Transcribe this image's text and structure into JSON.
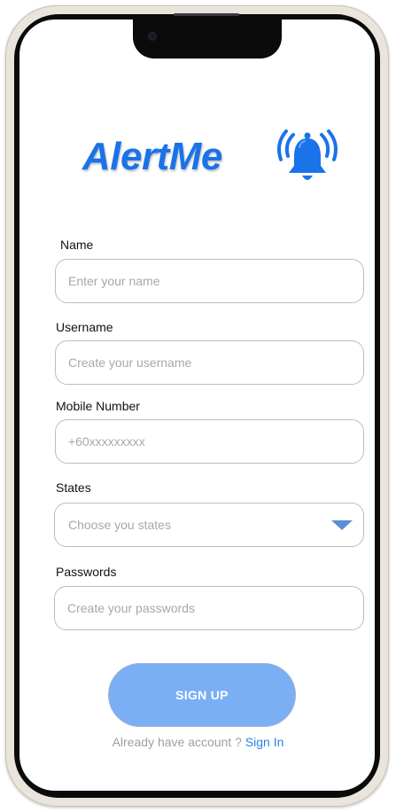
{
  "app": {
    "logo_text": "AlertMe",
    "brand_color": "#1a73e8",
    "logo_icon": "bell-icon"
  },
  "form": {
    "name": {
      "label": "Name",
      "placeholder": "Enter your name",
      "value": ""
    },
    "username": {
      "label": "Username",
      "placeholder": "Create your username",
      "value": ""
    },
    "mobile": {
      "label": "Mobile Number",
      "placeholder": "+60xxxxxxxxx",
      "value": ""
    },
    "states": {
      "label": "States",
      "selected": "Choose you states",
      "icon": "chevron-down-icon"
    },
    "password": {
      "label": "Passwords",
      "placeholder": "Create your passwords",
      "value": ""
    }
  },
  "actions": {
    "signup_label": "SIGN UP",
    "signup_color": "#7aaef5",
    "signin_prompt": "Already have account ?",
    "signin_link": "Sign In",
    "link_color": "#2a83e6"
  }
}
